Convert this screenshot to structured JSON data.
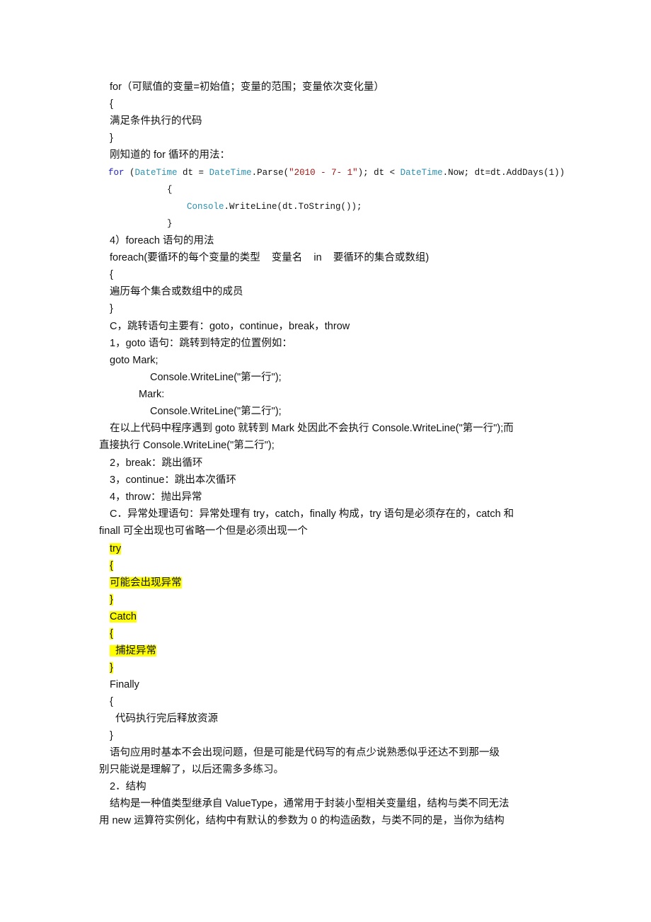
{
  "document": {
    "lines": {
      "for_syntax": "for（可赋值的变量=初始值；变量的范围；变量依次变化量）",
      "brace_open_1": "{",
      "for_body": "满足条件执行的代码",
      "brace_close_1": "}",
      "for_example_intro": "刚知道的 for 循环的用法：",
      "code_for_kw": "for",
      "code_paren": " (",
      "code_type1": "DateTime",
      "code_dt": " dt = ",
      "code_type2": "DateTime",
      "code_parse": ".Parse(",
      "code_str": "\"2010 - 7- 1\"",
      "code_cond": "); dt < ",
      "code_type3": "DateTime",
      "code_rest": ".Now; dt=dt.AddDays(1))",
      "code_brace_open": "{",
      "code_console": "Console",
      "code_writeline": ".WriteLine(dt.ToString());",
      "code_brace_close": "}",
      "foreach_heading": "4）foreach 语句的用法",
      "foreach_syntax": "foreach(要循环的每个变量的类型    变量名    in    要循环的集合或数组)",
      "brace_open_2": "{",
      "foreach_body": "遍历每个集合或数组中的成员",
      "brace_close_2": "}",
      "jump_heading": "C，跳转语句主要有：goto，continue，break，throw",
      "goto_heading": "1，goto 语句：跳转到特定的位置例如：",
      "goto_mark": "goto Mark;",
      "goto_line1": "Console.WriteLine(\"第一行\");",
      "goto_label": "Mark:",
      "goto_line2": "Console.WriteLine(\"第二行\");",
      "goto_explain_1": "在以上代码中程序遇到 goto 就转到 Mark 处因此不会执行 Console.WriteLine(\"第一行\");而",
      "goto_explain_2": "直接执行 Console.WriteLine(\"第二行\");",
      "break_item": "2，break：跳出循环",
      "continue_item": "3，continue：跳出本次循环",
      "throw_item": "4，throw：抛出异常",
      "exception_heading_1": "C．异常处理语句：异常处理有 try，catch，finally 构成，try 语句是必须存在的，catch 和",
      "exception_heading_2": "finall 可全出现也可省略一个但是必须出现一个",
      "try_kw": "try",
      "try_brace_open": "{",
      "try_body": "可能会出现异常",
      "try_brace_close": "}",
      "catch_kw": "Catch",
      "catch_brace_open": "{",
      "catch_body": "  捕捉异常",
      "catch_brace_close": "}",
      "finally_kw": "Finally",
      "finally_brace_open": "{",
      "finally_body": "  代码执行完后释放资源",
      "finally_brace_close": "}",
      "summary_1": "语句应用时基本不会出现问题，但是可能是代码写的有点少说熟悉似乎还达不到那一级",
      "summary_2": "别只能说是理解了，以后还需多多练习。",
      "struct_heading": "2．结构",
      "struct_para_1": "结构是一种值类型继承自 ValueType，通常用于封装小型相关变量组，结构与类不同无法",
      "struct_para_2": "用 new 运算符实例化，结构中有默认的参数为 0 的构造函数，与类不同的是，当你为结构"
    },
    "colors": {
      "keyword": "#1f1fd0",
      "type": "#2b91af",
      "string": "#a31515",
      "highlight": "#ffff00"
    }
  }
}
